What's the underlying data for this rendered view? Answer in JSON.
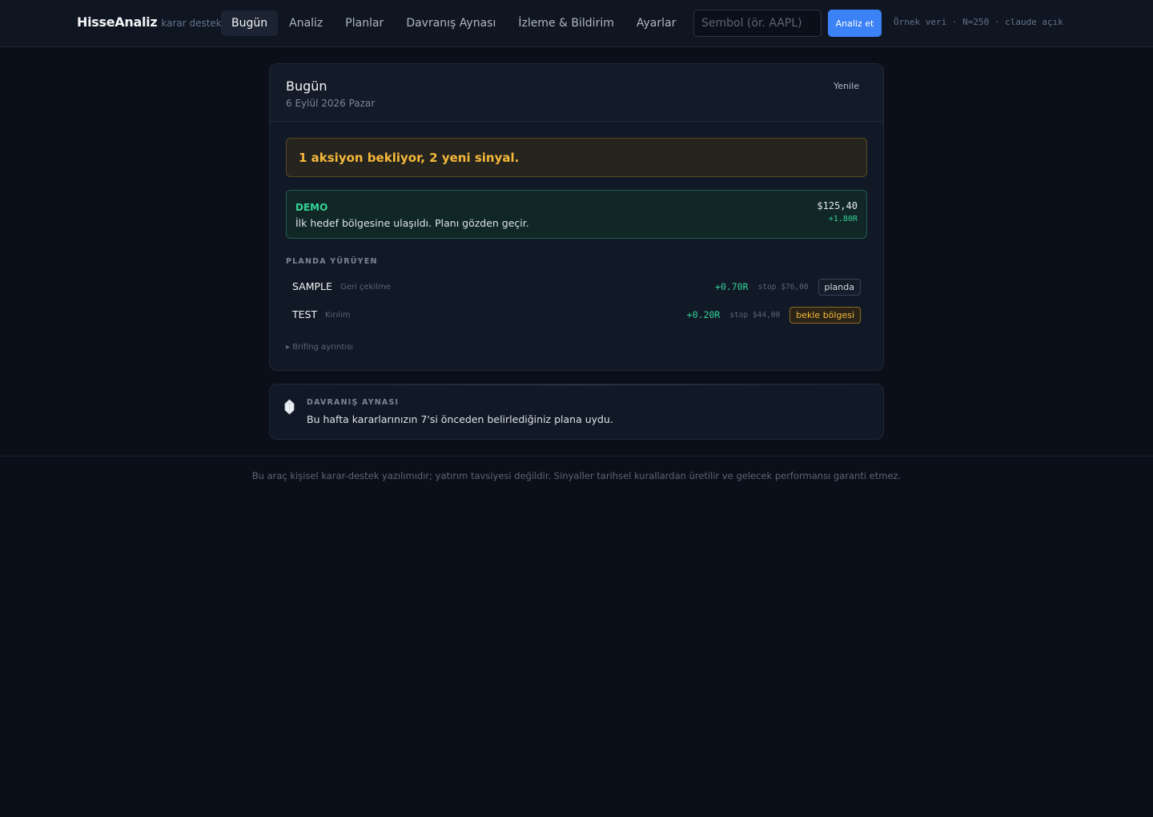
{
  "header": {
    "brand": "HisseAnaliz",
    "brand_tag": "karar destek",
    "nav": [
      {
        "label": "Bugün",
        "active": true
      },
      {
        "label": "Analiz"
      },
      {
        "label": "Planlar"
      },
      {
        "label": "Davranış Aynası"
      },
      {
        "label": "İzleme & Bildirim"
      },
      {
        "label": "Ayarlar"
      }
    ],
    "search_placeholder": "Sembol (ör. AAPL)",
    "analyze_label": "Analiz et",
    "status": "Örnek veri · N=250 · claude açık"
  },
  "today": {
    "title": "Bugün",
    "date": "6 Eylül 2026 Pazar",
    "refresh_label": "Yenile",
    "alert": "1 aksiyon bekliyor, 2 yeni sinyal.",
    "signal": {
      "symbol": "DEMO",
      "message": "İlk hedef bölgesine ulaşıldı. Planı gözden geçir.",
      "price": "$125,40",
      "r": "+1.80R"
    },
    "section_label": "PLANDA YÜRÜYEN",
    "plans": [
      {
        "symbol": "SAMPLE",
        "type": "Geri çekilme",
        "r": "+0.70R",
        "stop": "stop $76,00",
        "badge": "planda"
      },
      {
        "symbol": "TEST",
        "type": "Kırılım",
        "r": "+0.20R",
        "stop": "stop $44,00",
        "badge": "bekle bölgesi"
      }
    ],
    "briefing_link": "▸ Brifing ayrıntısı"
  },
  "mirror": {
    "label": "DAVRANIŞ AYNASI",
    "text": "Bu hafta kararlarınızın 7'si önceden belirlediğiniz plana uydu."
  },
  "footer": {
    "disclaimer": "Bu araç kişisel karar-destek yazılımıdır; yatırım tavsiyesi değildir. Sinyaller tarihsel kurallardan üretilir ve gelecek performansı garanti etmez."
  },
  "colors": {
    "accent": "#3b82f6",
    "positive": "#34d399",
    "warning": "#f5b83b",
    "background": "#0b0f19"
  },
  "icons": {
    "mirror": "gem-icon"
  }
}
